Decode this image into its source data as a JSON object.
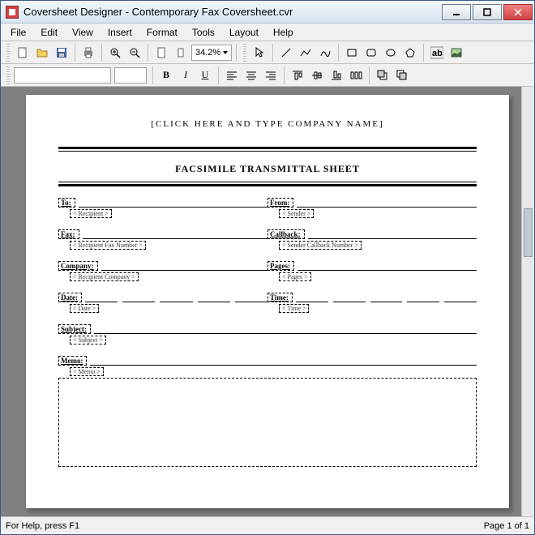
{
  "window": {
    "title": "Coversheet Designer - Contemporary Fax Coversheet.cvr"
  },
  "menu": {
    "file": "File",
    "edit": "Edit",
    "view": "View",
    "insert": "Insert",
    "format": "Format",
    "tools": "Tools",
    "layout": "Layout",
    "help": "Help"
  },
  "toolbar": {
    "zoom": "34.2%"
  },
  "doc": {
    "company_placeholder": "[CLICK  HERE  AND  TYPE  COMPANY  NAME]",
    "title": "FACSIMILE  TRANSMITTAL  SHEET",
    "fields": {
      "to": {
        "label": "To:",
        "value": "< Recipient >"
      },
      "from": {
        "label": "From:",
        "value": "< Sender >"
      },
      "fax": {
        "label": "Fax:",
        "value": "< Recipient Fax Number >"
      },
      "callback": {
        "label": "Callback:",
        "value": "< Sender Callback  Number >"
      },
      "company": {
        "label": "Company:",
        "value": "< Recipient Company >"
      },
      "pages": {
        "label": "Pages:",
        "value": "< Pages >"
      },
      "date": {
        "label": "Date:",
        "value": "< Date >"
      },
      "time": {
        "label": "Time:",
        "value": "< Time >"
      },
      "subject": {
        "label": "Subject:",
        "value": "< Subject >"
      },
      "memo": {
        "label": "Memo:",
        "value": "< Memo >"
      }
    }
  },
  "status": {
    "help": "For Help, press F1",
    "page": "Page 1 of 1"
  }
}
